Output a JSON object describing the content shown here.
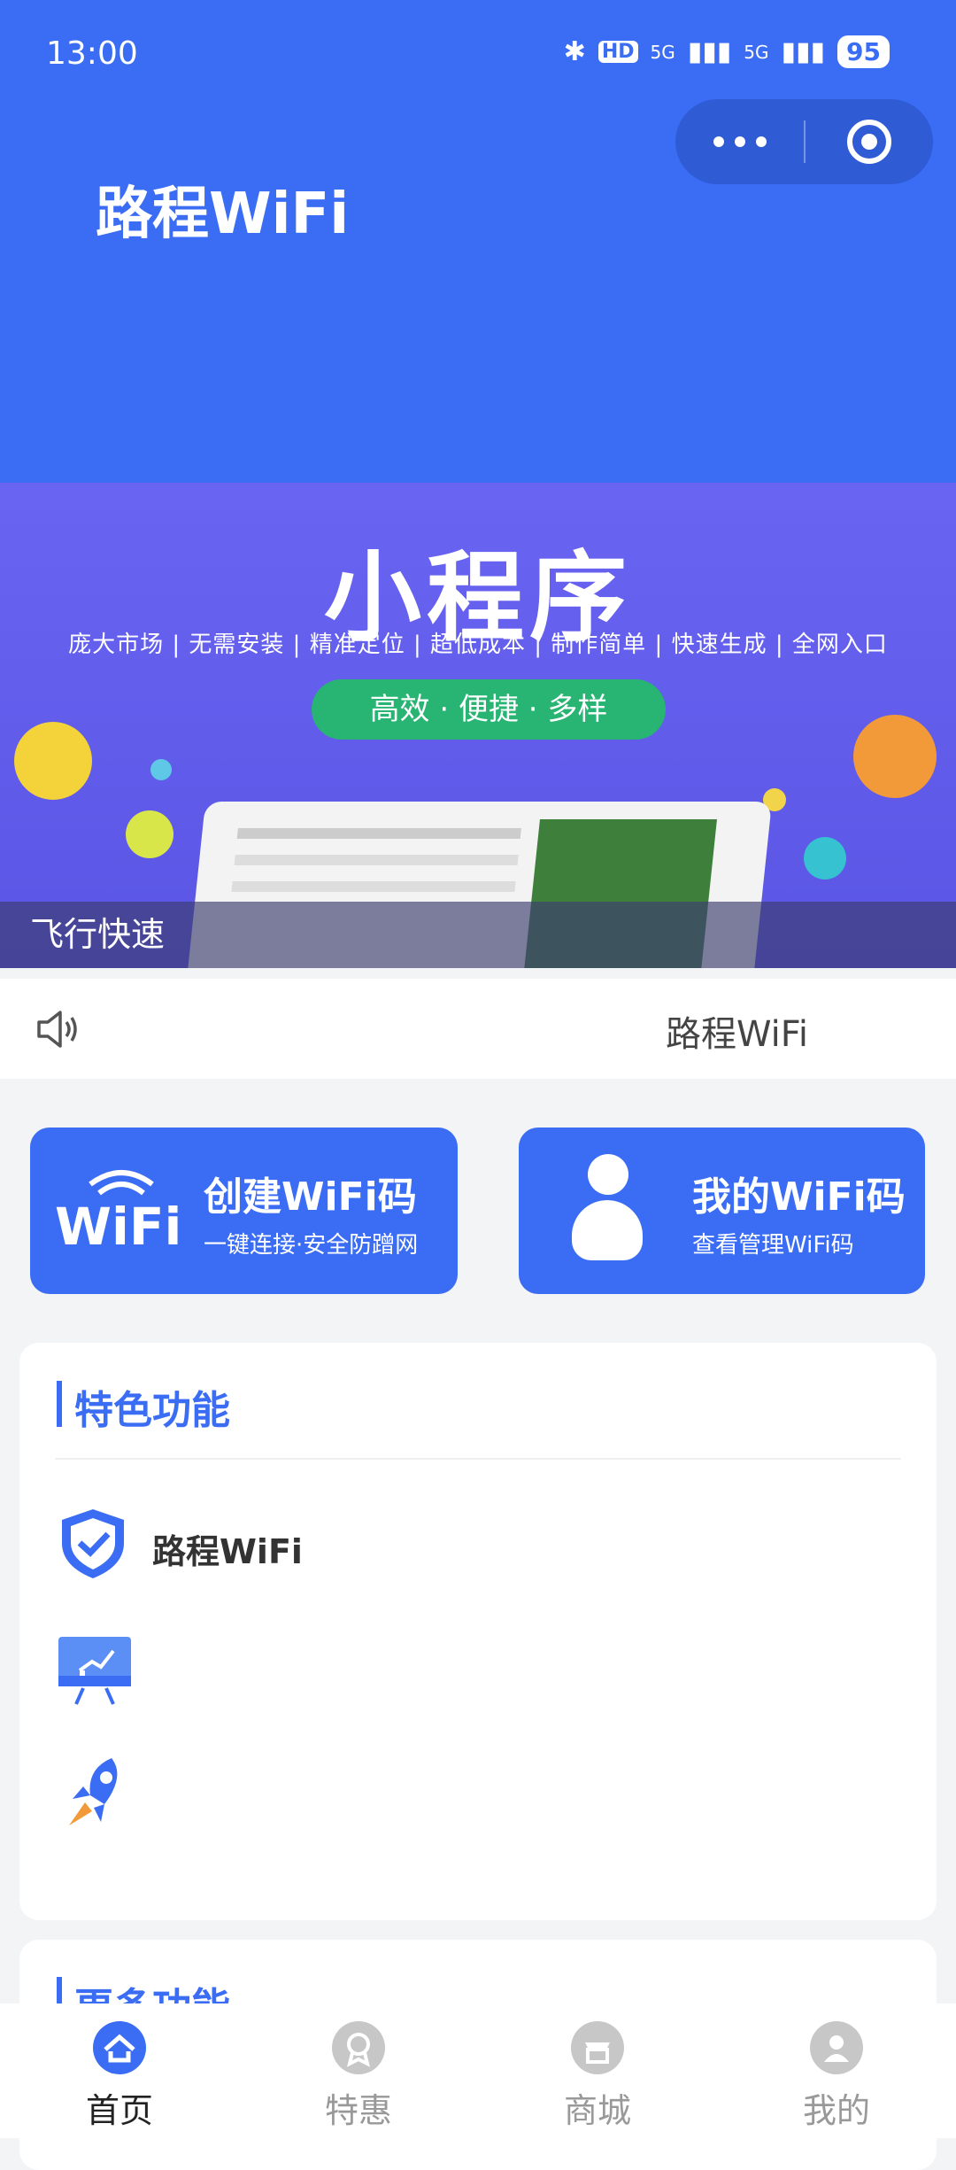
{
  "status_bar": {
    "time": "13:00",
    "hd": "HD",
    "net1": "5G",
    "net2": "5G",
    "battery": "95"
  },
  "header": {
    "title": "路程WiFi"
  },
  "banner": {
    "title": "小程序",
    "tags": "庞大市场 | 无需安装 | 精准定位 | 超低成本 | 制作简单 | 快速生成 | 全网入口",
    "pill": "高效 · 便捷 · 多样",
    "caption": "飞行快速"
  },
  "notice": {
    "text": "路程WiFi"
  },
  "actions": {
    "create": {
      "title": "创建WiFi码",
      "subtitle": "一键连接·安全防蹭网",
      "icon_text": "WiFi"
    },
    "mine": {
      "title": "我的WiFi码",
      "subtitle": "查看管理WiFi码"
    }
  },
  "features": {
    "title": "特色功能",
    "items": [
      {
        "label": "路程WiFi",
        "icon": "shield-check-icon"
      },
      {
        "label": "",
        "icon": "presentation-chart-icon"
      },
      {
        "label": "",
        "icon": "rocket-icon"
      }
    ]
  },
  "more": {
    "title": "更多功能"
  },
  "tabbar": {
    "items": [
      {
        "label": "首页",
        "icon": "home-icon",
        "active": true
      },
      {
        "label": "特惠",
        "icon": "medal-icon",
        "active": false
      },
      {
        "label": "商城",
        "icon": "store-icon",
        "active": false
      },
      {
        "label": "我的",
        "icon": "user-icon",
        "active": false
      }
    ]
  },
  "colors": {
    "primary": "#3a6cf4",
    "banner": "#6a64f2",
    "green": "#28b473"
  }
}
